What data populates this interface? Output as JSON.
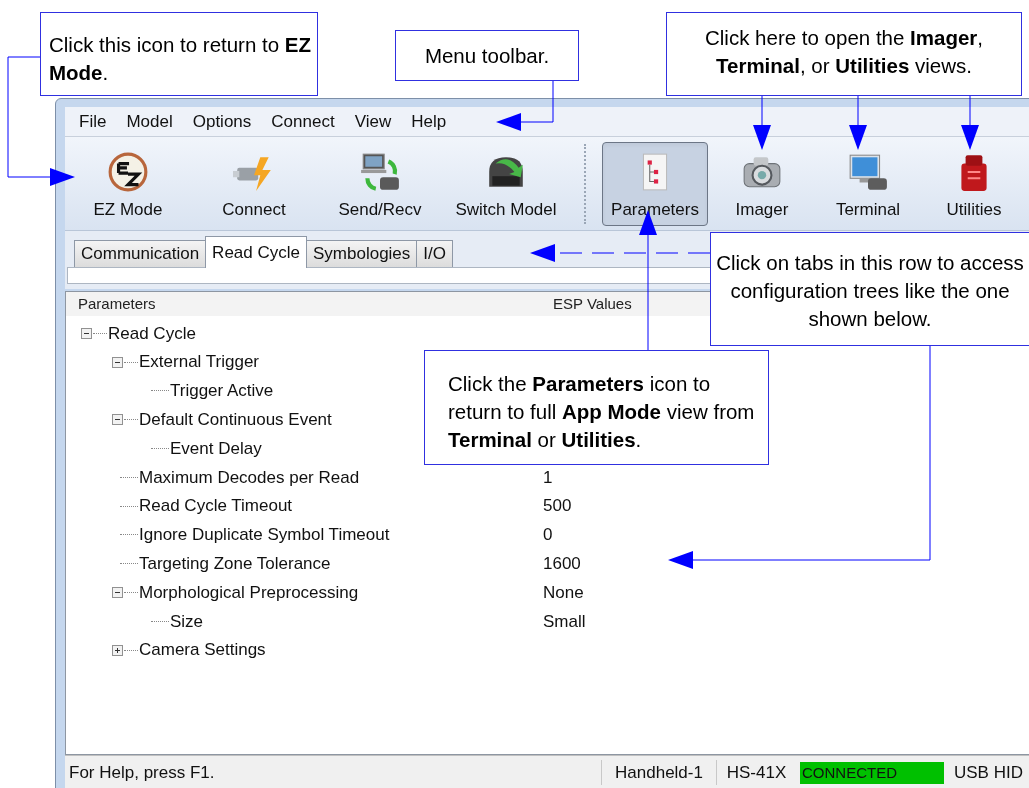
{
  "menu": [
    "File",
    "Model",
    "Options",
    "Connect",
    "View",
    "Help"
  ],
  "toolbar": {
    "groups": [
      [
        {
          "label": "EZ Mode",
          "kind": "ez",
          "selected": false
        },
        {
          "label": "Connect",
          "kind": "connect",
          "selected": false
        },
        {
          "label": "Send/Recv",
          "kind": "sendrecv",
          "selected": false
        },
        {
          "label": "Switch Model",
          "kind": "switch",
          "selected": false
        }
      ],
      [
        {
          "label": "Parameters",
          "kind": "parameters",
          "selected": true
        },
        {
          "label": "Imager",
          "kind": "imager",
          "selected": false
        },
        {
          "label": "Terminal",
          "kind": "terminal",
          "selected": false
        },
        {
          "label": "Utilities",
          "kind": "utilities",
          "selected": false
        }
      ]
    ]
  },
  "tabs": [
    {
      "label": "Communication",
      "selected": false
    },
    {
      "label": "Read Cycle",
      "selected": true
    },
    {
      "label": "Symbologies",
      "selected": false
    },
    {
      "label": "I/O",
      "selected": false
    }
  ],
  "tree": {
    "columns": [
      "Parameters",
      "ESP Values"
    ],
    "nodes": [
      {
        "label": "Read Cycle",
        "expanded": true,
        "children": [
          {
            "label": "External Trigger",
            "expanded": true,
            "children": [
              {
                "label": "Trigger Active"
              }
            ]
          },
          {
            "label": "Default Continuous Event",
            "expanded": true,
            "children": [
              {
                "label": "Event Delay"
              }
            ]
          },
          {
            "label": "Maximum Decodes per Read",
            "value": "1"
          },
          {
            "label": "Read Cycle Timeout",
            "value": "500"
          },
          {
            "label": "Ignore Duplicate Symbol Timeout",
            "value": "0"
          },
          {
            "label": "Targeting Zone Tolerance",
            "value": "1600"
          },
          {
            "label": "Morphological Preprocessing",
            "value": "None",
            "expanded": true,
            "children": [
              {
                "label": "Size",
                "value": "Small"
              }
            ]
          },
          {
            "label": "Camera Settings",
            "expanded": false
          }
        ]
      }
    ]
  },
  "status_bar": [
    {
      "text": "For Help, press F1.",
      "kind": "message"
    },
    {
      "text": "Handheld-1",
      "kind": "field"
    },
    {
      "text": "HS-41X",
      "kind": "field"
    },
    {
      "text": "CONNECTED",
      "kind": "connection"
    },
    {
      "text": "USB HID",
      "kind": "field"
    }
  ],
  "callouts": [
    {
      "text": "Click this icon to return to **EZ Mode**."
    },
    {
      "text": "Menu toolbar."
    },
    {
      "text": "Click here to open the **Imager**, **Terminal**, or **Utilities** views."
    },
    {
      "text": "Click on tabs in this row to access configuration trees like the one shown below."
    },
    {
      "text": "Click the **Parameters** icon to return to full **App Mode** view from **Terminal** or **Utilities**."
    }
  ]
}
